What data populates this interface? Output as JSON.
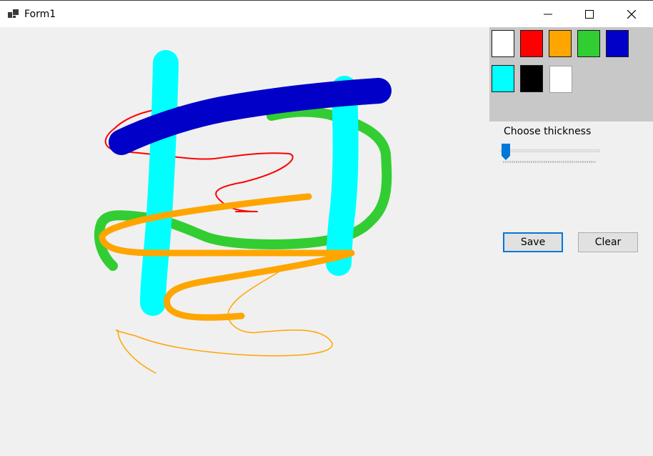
{
  "window": {
    "title": "Form1",
    "icon": "winforms-app-icon",
    "controls": [
      "minimize-icon",
      "maximize-icon",
      "close-icon"
    ]
  },
  "palette": {
    "background": "#c8c8c8",
    "swatches": [
      {
        "name": "white",
        "color": "#ffffff"
      },
      {
        "name": "red",
        "color": "#ff0000"
      },
      {
        "name": "orange",
        "color": "#ffa500"
      },
      {
        "name": "green",
        "color": "#32cd32"
      },
      {
        "name": "blue",
        "color": "#0000c8"
      },
      {
        "name": "cyan",
        "color": "#00ffff"
      },
      {
        "name": "black",
        "color": "#000000"
      },
      {
        "name": "white-2",
        "color": "#ffffff"
      }
    ]
  },
  "thickness": {
    "label": "Choose thickness",
    "value": 0,
    "min": 0,
    "max": 100,
    "accent": "#0078d7"
  },
  "buttons": {
    "save_label": "Save",
    "clear_label": "Clear"
  },
  "strokes": [
    {
      "color": "#ff0000",
      "width": 2
    },
    {
      "color": "#ffa500",
      "width": 1.5
    },
    {
      "color": "#32cd32",
      "width": 14
    },
    {
      "color": "#00ffff",
      "width": 36
    },
    {
      "color": "#00ffff",
      "width": 36
    },
    {
      "color": "#ffa500",
      "width": 9
    },
    {
      "color": "#0000c8",
      "width": 36
    }
  ]
}
